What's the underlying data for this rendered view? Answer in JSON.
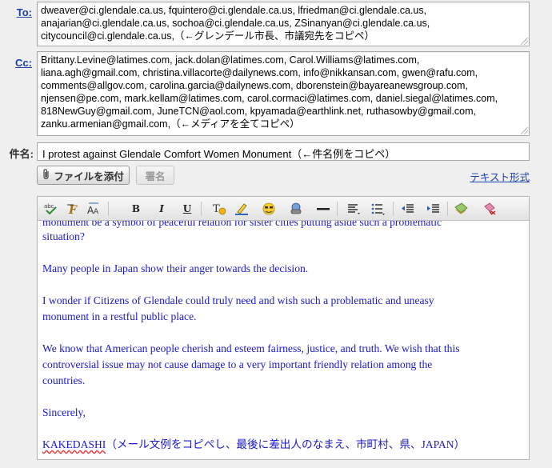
{
  "to": {
    "label": "To:",
    "lines": [
      "dweaver@ci.glendale.ca.us, fquintero@ci.glendale.ca.us, lfriedman@ci.glendale.ca.us,",
      "anajarian@ci.glendale.ca.us, sochoa@ci.glendale.ca.us, ZSinanyan@ci.glendale.ca.us,",
      "citycouncil@ci.glendale.ca.us,（←グレンデール市長、市議宛先をコピペ）"
    ]
  },
  "cc": {
    "label": "Cc:",
    "lines": [
      "Brittany.Levine@latimes.com, jack.dolan@latimes.com, Carol.Williams@latimes.com,",
      "liana.agh@gmail.com, christina.villacorte@dailynews.com, info@nikkansan.com, gwen@rafu.com,",
      "comments@allgov.com, carolina.garcia@dailynews.com, dborenstein@bayareanewsgroup.com,",
      "njensen@pe.com, mark.kellam@latimes.com, carol.cormaci@latimes.com, daniel.siegal@latimes.com,",
      "818NewGuy@gmail.com, JuneTCN@aol.com, kpyamada@earthlink.net, ruthasowby@gmail.com,",
      "zanku.armenian@gmail.com,（←メディアを全てコピペ）"
    ]
  },
  "subject": {
    "label": "件名:",
    "value": "I protest against Glendale Comfort Women Monument（←件名例をコピペ）"
  },
  "buttons": {
    "attach_label": "ファイルを添付",
    "signature_label": "署名",
    "plain_text_label": "テキスト形式"
  },
  "toolbar": [
    {
      "name": "spellcheck-icon",
      "glyph": "abc"
    },
    {
      "name": "font-icon",
      "glyph": "F"
    },
    {
      "name": "font-size-icon",
      "glyph": "AA"
    },
    {
      "name": "bold-icon",
      "glyph": "B"
    },
    {
      "name": "italic-icon",
      "glyph": "I"
    },
    {
      "name": "underline-icon",
      "glyph": "U"
    },
    {
      "name": "text-color-icon",
      "glyph": "T"
    },
    {
      "name": "highlight-icon",
      "glyph": "✎"
    },
    {
      "name": "emoticon-icon",
      "glyph": "☺"
    },
    {
      "name": "link-icon",
      "glyph": "⛓"
    },
    {
      "name": "horizontal-rule-icon",
      "glyph": "—"
    },
    {
      "name": "align-icon",
      "glyph": "≡"
    },
    {
      "name": "bullet-list-icon",
      "glyph": "☰"
    },
    {
      "name": "outdent-icon",
      "glyph": "⇤"
    },
    {
      "name": "indent-icon",
      "glyph": "⇥"
    },
    {
      "name": "insert-image-icon",
      "glyph": "▣"
    },
    {
      "name": "remove-format-icon",
      "glyph": "⌫"
    }
  ],
  "body": {
    "partial_line": "monument be  a symbol of peaceful relation for sister cities  putting aside such a problematic",
    "p1_end": "situation?",
    "p2": "Many people in Japan show their anger towards the decision.",
    "p3_l1": "I wonder if Citizens of Glendale could truly need and wish such a problematic and uneasy",
    "p3_l2": "monument in a restful public place.",
    "p4_l1": "We know that American people cherish and esteem fairness, justice, and truth. We wish that this",
    "p4_l2": "controversial issue may not cause damage to a very important friendly relation among the",
    "p4_l3": "countries.",
    "closing": "Sincerely,",
    "sig_name": "KAKEDASHI",
    "sig_note": "（メール文例をコピペし、最後に差出人のなまえ、市町村、県、JAPAN）"
  },
  "colors": {
    "body_text": "#1a1acc",
    "link": "#1a3fb0"
  }
}
